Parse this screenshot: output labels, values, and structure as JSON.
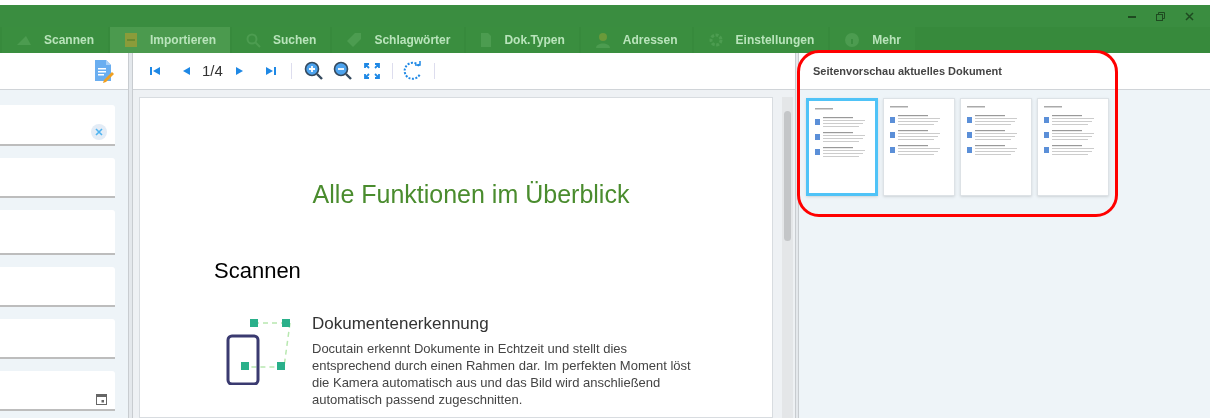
{
  "tabs": [
    {
      "label": "Scannen",
      "selected": false
    },
    {
      "label": "Importieren",
      "selected": true
    },
    {
      "label": "Suchen",
      "selected": false
    },
    {
      "label": "Schlagwörter",
      "selected": false
    },
    {
      "label": "Dok.Typen",
      "selected": false
    },
    {
      "label": "Adressen",
      "selected": false
    },
    {
      "label": "Einstellungen",
      "selected": false
    },
    {
      "label": "Mehr",
      "selected": false
    }
  ],
  "fields": [
    {
      "kind": "clearable"
    },
    {
      "kind": "plain"
    },
    {
      "kind": "plain"
    },
    {
      "kind": "plain"
    },
    {
      "kind": "plain"
    },
    {
      "kind": "date"
    }
  ],
  "viewer": {
    "page_indicator": "1/4",
    "document": {
      "title": "Alle Funktionen im Überblick",
      "section": "Scannen",
      "feature_title": "Dokumentenerkennung",
      "feature_text": "Docutain erkennt Dokumente in Echtzeit und stellt dies entsprechend durch einen Rahmen dar. Im perfekten Moment löst die Kamera automatisch aus und das Bild wird anschließend automatisch passend zugeschnitten."
    }
  },
  "preview": {
    "title": "Seitenvorschau aktuelles Dokument",
    "thumbnails": [
      {
        "selected": true
      },
      {
        "selected": false
      },
      {
        "selected": false
      },
      {
        "selected": false
      }
    ]
  }
}
